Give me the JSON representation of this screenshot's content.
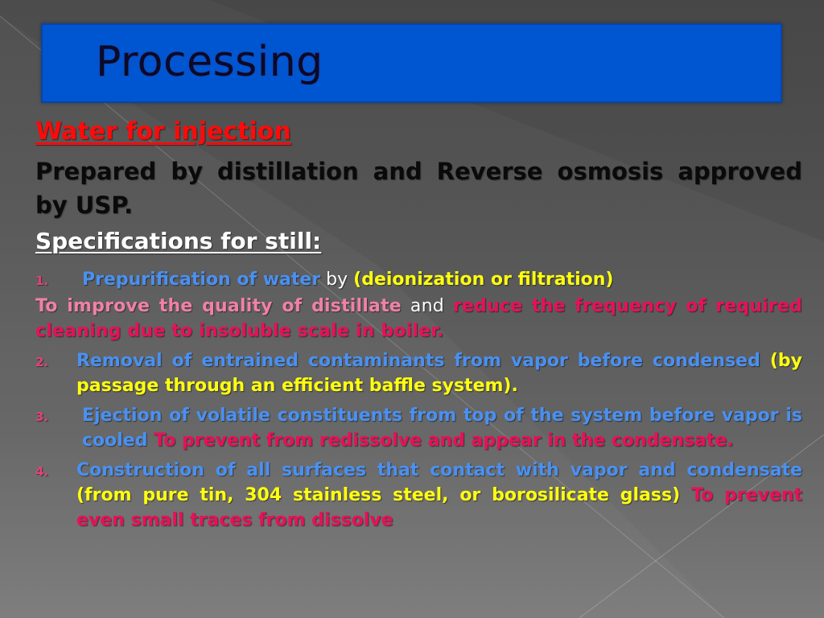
{
  "slide": {
    "title": "Processing",
    "heading": "Water for injection",
    "intro": "Prepared by distillation and Reverse osmosis approved by USP.",
    "subheading": "Specifications for still:",
    "items": [
      {
        "number": "1.",
        "parts": [
          {
            "text": "Prepurification of water",
            "color": "blue"
          },
          {
            "text": " by ",
            "color": "white"
          },
          {
            "text": "(deionization or filtration)",
            "color": "yellow"
          }
        ]
      },
      {
        "number": "2.",
        "parts": [
          {
            "text": "Removal of entrained contaminants from vapor before condensed",
            "color": "blue"
          },
          {
            "text": " (by passage through an efficient baffle system).",
            "color": "yellow"
          }
        ]
      },
      {
        "number": "3.",
        "parts": [
          {
            "text": "Ejection of volatile constituents from top of the system before vapor is cooled",
            "color": "blue"
          },
          {
            "text": " To prevent from redissolve and appear in the condensate.",
            "color": "magenta"
          }
        ]
      },
      {
        "number": "4.",
        "parts": [
          {
            "text": "Construction of all surfaces that contact with vapor and condensate",
            "color": "blue"
          },
          {
            "text": " (from pure tin, 304 stainless steel, or borosilicate glass)",
            "color": "yellow"
          },
          {
            "text": " To prevent even small traces from dissolve",
            "color": "magenta"
          }
        ]
      }
    ],
    "note1": {
      "part1": "To improve the quality of distillate",
      "part2": " and ",
      "part3": "reduce the frequency of required cleaning due to insoluble scale in boiler."
    }
  },
  "colors": {
    "title_bar": "#0055d0",
    "heading_red": "#ff0a0a",
    "blue": "#4a90f0",
    "yellow": "#ffff10",
    "magenta": "#e8105a",
    "pink": "#f080a8",
    "number_pink": "#e8407a"
  }
}
